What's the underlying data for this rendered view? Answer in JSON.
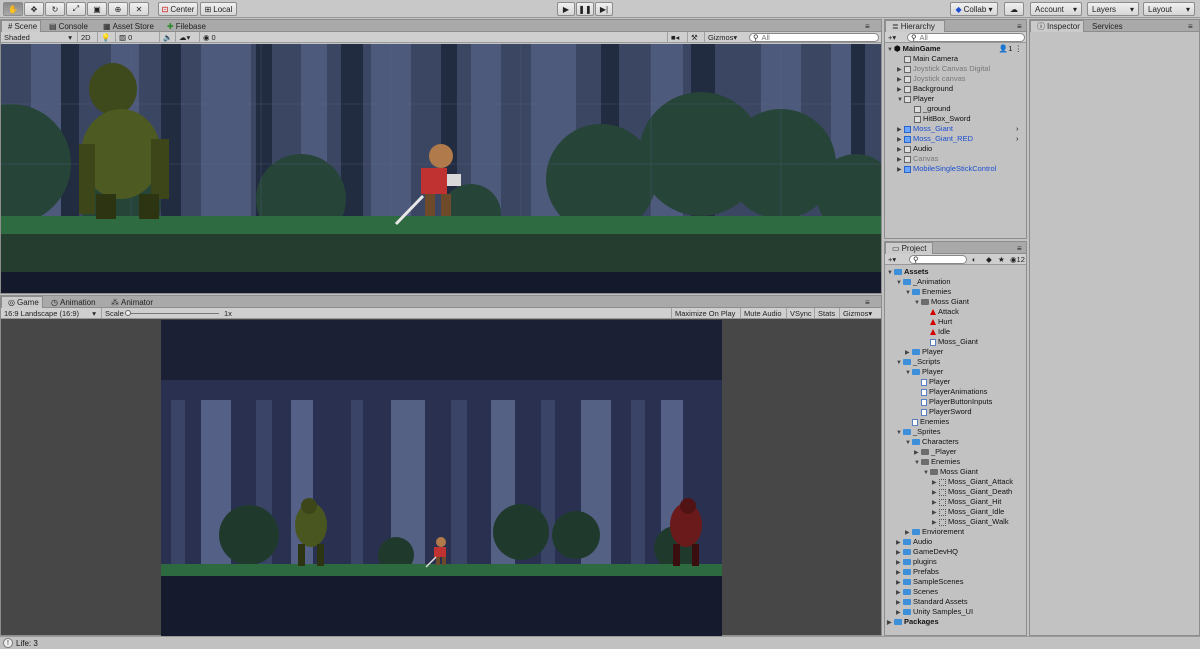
{
  "toolbar": {
    "pivot_label": "Center",
    "space_label": "Local",
    "collab_label": "Collab ▾",
    "account_label": "Account",
    "layers_label": "Layers",
    "layout_label": "Layout"
  },
  "scene_tabs": [
    "Scene",
    "Console",
    "Asset Store",
    "Filebase"
  ],
  "scene_controls": {
    "shading": "Shaded",
    "mode_2d": "2D",
    "layer_count": "0",
    "gizmo_count": "0",
    "gizmos_label": "Gizmos",
    "search_placeholder": "All"
  },
  "game_tabs": [
    "Game",
    "Animation",
    "Animator"
  ],
  "game_controls": {
    "aspect": "16:9 Landscape (16:9)",
    "scale_label": "Scale",
    "scale_value": "1x",
    "maximize": "Maximize On Play",
    "mute": "Mute Audio",
    "vsync": "VSync",
    "stats": "Stats",
    "gizmos": "Gizmos"
  },
  "hierarchy": {
    "tab": "Hierarchy",
    "search_placeholder": "All",
    "scene_name": "MainGame",
    "users_count": "1",
    "items": [
      {
        "label": "Main Camera",
        "depth": 1,
        "style": "normal"
      },
      {
        "label": "Joystick Canvas Digital",
        "depth": 1,
        "style": "grey"
      },
      {
        "label": "Joystick canvas",
        "depth": 1,
        "style": "grey"
      },
      {
        "label": "Background",
        "depth": 1,
        "style": "normal"
      },
      {
        "label": "Player",
        "depth": 1,
        "style": "normal"
      },
      {
        "label": "_ground",
        "depth": 2,
        "style": "normal"
      },
      {
        "label": "HitBox_Sword",
        "depth": 2,
        "style": "normal"
      },
      {
        "label": "Moss_Giant",
        "depth": 1,
        "style": "blue"
      },
      {
        "label": "Moss_Giant_RED",
        "depth": 1,
        "style": "blue"
      },
      {
        "label": "Audio",
        "depth": 1,
        "style": "normal"
      },
      {
        "label": "Canvas",
        "depth": 1,
        "style": "grey"
      },
      {
        "label": "MobileSingleStickControl",
        "depth": 1,
        "style": "blue"
      }
    ]
  },
  "inspector": {
    "tab": "Inspector",
    "services_tab": "Services"
  },
  "project": {
    "tab": "Project",
    "count": "12",
    "items": [
      {
        "label": "Assets",
        "depth": 0,
        "icon": "folder",
        "bold": true
      },
      {
        "label": "_Animation",
        "depth": 1,
        "icon": "folder"
      },
      {
        "label": "Enemies",
        "depth": 2,
        "icon": "folder"
      },
      {
        "label": "Moss Giant",
        "depth": 3,
        "icon": "folder"
      },
      {
        "label": "Attack",
        "depth": 4,
        "icon": "anim"
      },
      {
        "label": "Hurt",
        "depth": 4,
        "icon": "anim"
      },
      {
        "label": "Idle",
        "depth": 4,
        "icon": "anim"
      },
      {
        "label": "Moss_Giant",
        "depth": 4,
        "icon": "controller"
      },
      {
        "label": "Player",
        "depth": 2,
        "icon": "folder"
      },
      {
        "label": "_Scripts",
        "depth": 1,
        "icon": "folder"
      },
      {
        "label": "Player",
        "depth": 2,
        "icon": "folder"
      },
      {
        "label": "Player",
        "depth": 3,
        "icon": "script"
      },
      {
        "label": "PlayerAnimations",
        "depth": 3,
        "icon": "script"
      },
      {
        "label": "PlayerButtonInputs",
        "depth": 3,
        "icon": "script"
      },
      {
        "label": "PlayerSword",
        "depth": 3,
        "icon": "script"
      },
      {
        "label": "Enemies",
        "depth": 2,
        "icon": "script"
      },
      {
        "label": "_Sprites",
        "depth": 1,
        "icon": "folder"
      },
      {
        "label": "Characters",
        "depth": 2,
        "icon": "folder"
      },
      {
        "label": "_Player",
        "depth": 3,
        "icon": "folder"
      },
      {
        "label": "Enemies",
        "depth": 3,
        "icon": "folder"
      },
      {
        "label": "Moss Giant",
        "depth": 4,
        "icon": "folder"
      },
      {
        "label": "Moss_Giant_Attack",
        "depth": 5,
        "icon": "sprite"
      },
      {
        "label": "Moss_Giant_Death",
        "depth": 5,
        "icon": "sprite"
      },
      {
        "label": "Moss_Giant_Hit",
        "depth": 5,
        "icon": "sprite"
      },
      {
        "label": "Moss_Giant_Idle",
        "depth": 5,
        "icon": "sprite"
      },
      {
        "label": "Moss_Giant_Walk",
        "depth": 5,
        "icon": "sprite"
      },
      {
        "label": "Enviorement",
        "depth": 2,
        "icon": "folder"
      },
      {
        "label": "Audio",
        "depth": 1,
        "icon": "folder"
      },
      {
        "label": "GameDevHQ",
        "depth": 1,
        "icon": "folder"
      },
      {
        "label": "plugins",
        "depth": 1,
        "icon": "folder"
      },
      {
        "label": "Prefabs",
        "depth": 1,
        "icon": "folder"
      },
      {
        "label": "SampleScenes",
        "depth": 1,
        "icon": "folder"
      },
      {
        "label": "Scenes",
        "depth": 1,
        "icon": "folder"
      },
      {
        "label": "Standard Assets",
        "depth": 1,
        "icon": "folder"
      },
      {
        "label": "Unity Samples_UI",
        "depth": 1,
        "icon": "folder"
      },
      {
        "label": "Packages",
        "depth": 0,
        "icon": "folder",
        "bold": true
      }
    ]
  },
  "status": {
    "message": "Life: 3"
  }
}
